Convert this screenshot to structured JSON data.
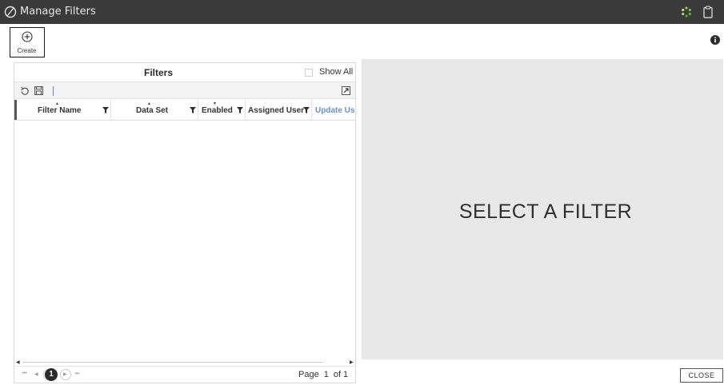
{
  "window": {
    "title": "Manage Filters",
    "logo_icon": "slashed-circle-logo-icon",
    "status_icon": "loading-spinner-icon",
    "clipboard_icon": "clipboard-icon"
  },
  "toolbar_main": {
    "create_label": "Create",
    "create_icon": "plus-circle-icon",
    "info_icon": "info-icon"
  },
  "filters_panel": {
    "title": "Filters",
    "show_all_label": "Show All",
    "show_all_checked": false,
    "tools": [
      "refresh-icon",
      "save-icon",
      "expand-icon"
    ],
    "columns": [
      {
        "label": "Filter Name",
        "sort": "asc",
        "filterable": true
      },
      {
        "label": "Data Set",
        "sort": "asc",
        "filterable": true
      },
      {
        "label": "Enabled",
        "sort": "desc",
        "filterable": true
      },
      {
        "label": "Assigned User",
        "sort": "none",
        "filterable": true
      },
      {
        "label": "Update Use",
        "sort": "none",
        "filterable": false
      }
    ],
    "rows": [],
    "pager": {
      "current_page": "1",
      "page_label": "Page",
      "page_value": "1",
      "of_label": "of 1"
    }
  },
  "detail_panel": {
    "placeholder": "SELECT A FILTER"
  },
  "footer": {
    "close_label": "CLOSE"
  },
  "colors": {
    "titlebar": "#3a3a3a",
    "detail_bg": "#e8e8e8",
    "link_header": "#6b8fc5",
    "pager_current": "#2b2b2b"
  }
}
